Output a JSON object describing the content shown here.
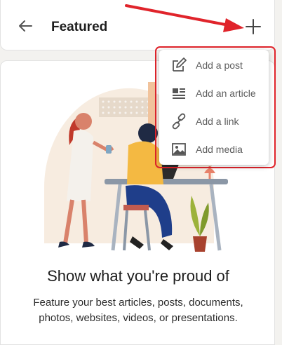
{
  "header": {
    "title": "Featured"
  },
  "menu": {
    "items": [
      {
        "label": "Add a post",
        "icon": "edit-icon"
      },
      {
        "label": "Add an article",
        "icon": "article-icon"
      },
      {
        "label": "Add a link",
        "icon": "link-icon"
      },
      {
        "label": "Add media",
        "icon": "image-icon"
      }
    ]
  },
  "empty_state": {
    "title": "Show what you're proud of",
    "description": "Feature your best articles, posts, documents, photos, websites, videos, or presentations."
  },
  "colors": {
    "highlight": "#e0242b",
    "menu_text": "#5c5c5c",
    "heading": "#1d1d1d"
  }
}
